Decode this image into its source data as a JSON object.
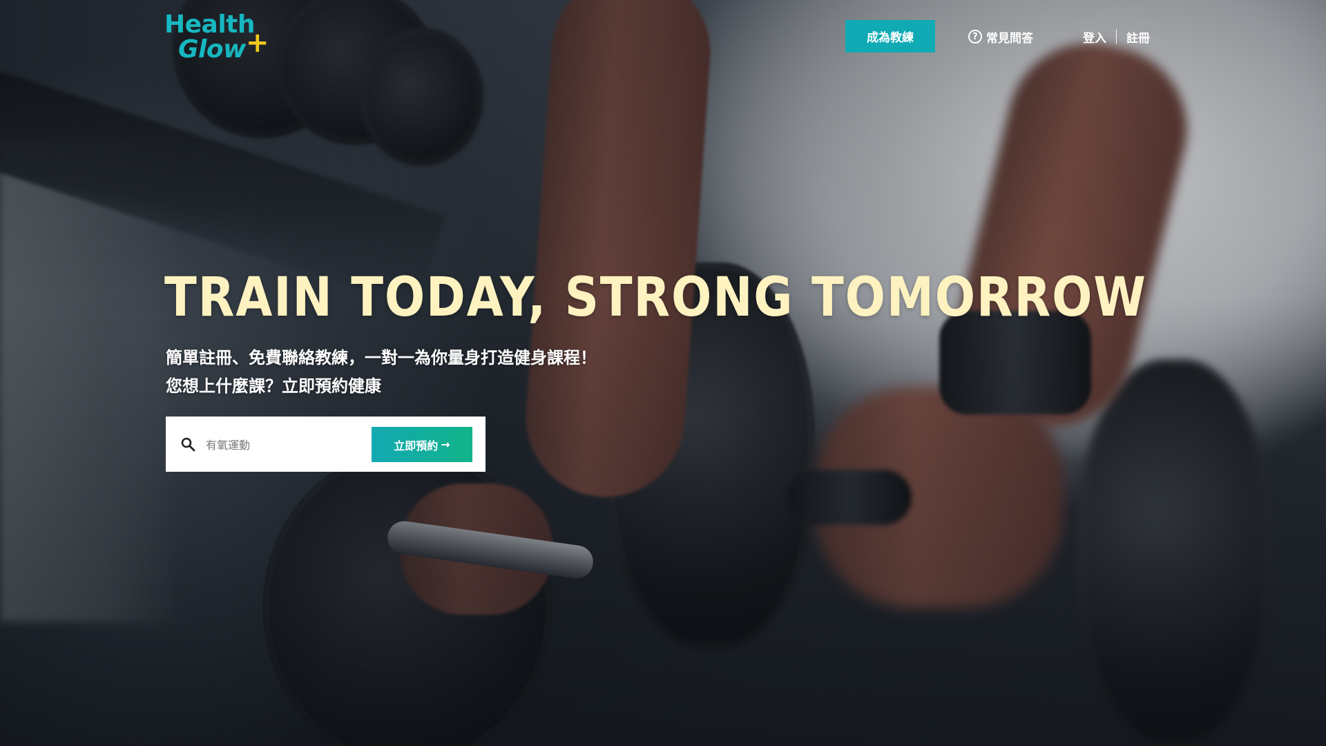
{
  "brand": {
    "logo_line1": "Health",
    "logo_line2": "Glow",
    "logo_plus": "+",
    "primary_color": "#10aab4",
    "accent_color": "#f2c81e"
  },
  "nav": {
    "become_coach_label": "成為教練",
    "faq_icon": "question-circle-icon",
    "faq_label": "常見問答",
    "login_label": "登入",
    "register_label": "註冊"
  },
  "hero": {
    "headline": "TRAIN TODAY, STRONG TOMORROW",
    "headline_color": "#fdf2c0",
    "subtitle_line1": "簡單註冊、免費聯絡教練，一對一為你量身打造健身課程！",
    "subtitle_line2": "您想上什麼課？立即預約健康"
  },
  "search": {
    "icon": "search-icon",
    "placeholder": "有氧運動",
    "value": "",
    "button_label": "立即預約",
    "button_arrow": "→"
  }
}
